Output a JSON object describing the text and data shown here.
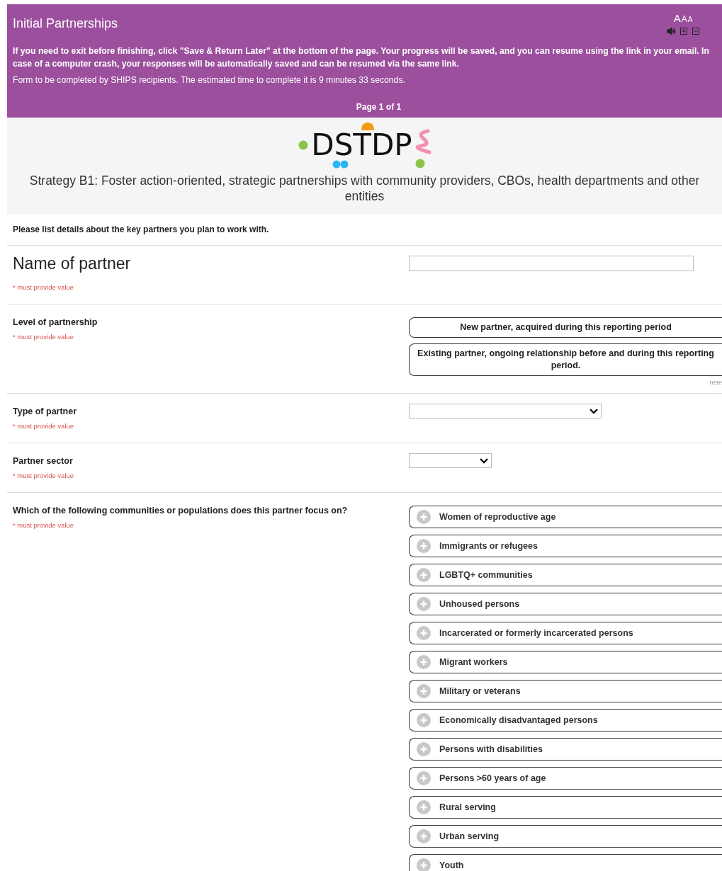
{
  "header": {
    "title": "Initial Partnerships",
    "text_size_letters": [
      "A",
      "A",
      "A"
    ],
    "notice": "If you need to exit before finishing, click \"Save & Return Later\" at the bottom of the page. Your progress will be saved, and you can resume using the link in your email. In case of a computer crash, your responses will be automatically saved and can be resumed via the same link.",
    "estimate": "Form to be completed by SHIPS recipients. The estimated time to complete it is 9 minutes 33 seconds.",
    "page_indicator": "Page 1 of 1"
  },
  "logo": {
    "text": "DSTDP"
  },
  "strategy": "Strategy B1: Foster action-oriented, strategic partnerships with community providers, CBOs, health departments and other entities",
  "intro": "Please list details about the key partners you plan to work with.",
  "fields": [
    {
      "kind": "text",
      "label": "Name of partner",
      "required_note": "* must provide value"
    },
    {
      "kind": "radio",
      "label": "Level of partnership",
      "required_note": "* must provide value",
      "reset": "rese",
      "options": [
        {
          "label": "New partner, acquired during this reporting period",
          "selected": false
        },
        {
          "label": "Existing partner, ongoing relationship before and during this reporting period.",
          "selected": false
        }
      ]
    },
    {
      "kind": "select",
      "label": "Type of partner",
      "required_note": "* must provide value"
    },
    {
      "kind": "select",
      "label": "Partner sector",
      "required_note": "* must provide value"
    },
    {
      "kind": "checkbox",
      "label": "Which of the following communities or populations does this partner focus on?",
      "required_note": "* must provide value",
      "options": [
        {
          "label": "Women of reproductive age",
          "checked": false
        },
        {
          "label": "Immigrants or refugees",
          "checked": false
        },
        {
          "label": "LGBTQ+ communities",
          "checked": false
        },
        {
          "label": "Unhoused persons",
          "checked": false
        },
        {
          "label": "Incarcerated or formerly incarcerated persons",
          "checked": false
        },
        {
          "label": "Migrant workers",
          "checked": false
        },
        {
          "label": "Military or veterans",
          "checked": false
        },
        {
          "label": "Economically disadvantaged persons",
          "checked": false
        },
        {
          "label": "Persons with disabilities",
          "checked": false
        },
        {
          "label": "Persons >60 years of age",
          "checked": false
        },
        {
          "label": "Rural serving",
          "checked": false
        },
        {
          "label": "Urban serving",
          "checked": false
        },
        {
          "label": "Youth",
          "checked": false
        }
      ]
    }
  ]
}
